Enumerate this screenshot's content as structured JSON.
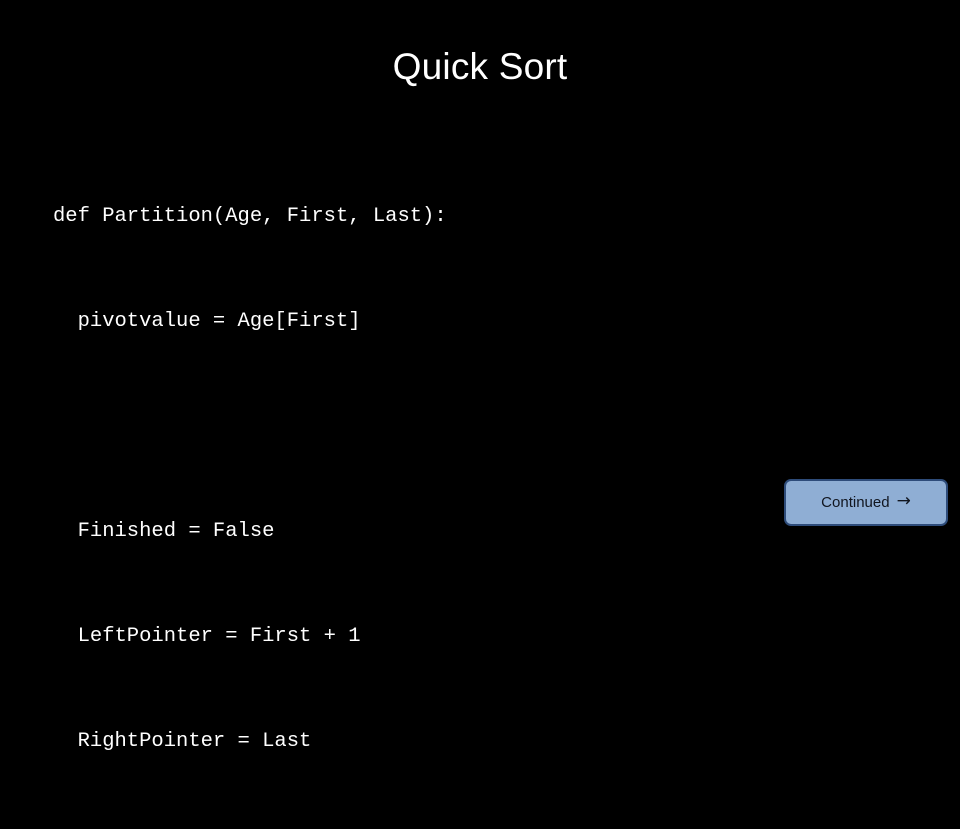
{
  "slide": {
    "background_color": "#000000",
    "title": "Quick Sort",
    "title_color": "#FFFFFF"
  },
  "code": {
    "language": "python",
    "text_color": "#FFFFFF",
    "lines": [
      "def Partition(Age, First, Last):",
      "  pivotvalue = Age[First]",
      "",
      "  Finished = False",
      "  LeftPointer = First + 1",
      "  RightPointer = Last"
    ]
  },
  "continued_button": {
    "label": "Continued",
    "arrow_glyph": "→",
    "fill_color": "#8FAED4",
    "border_color": "#2E4C7A",
    "text_color": "#111620"
  }
}
